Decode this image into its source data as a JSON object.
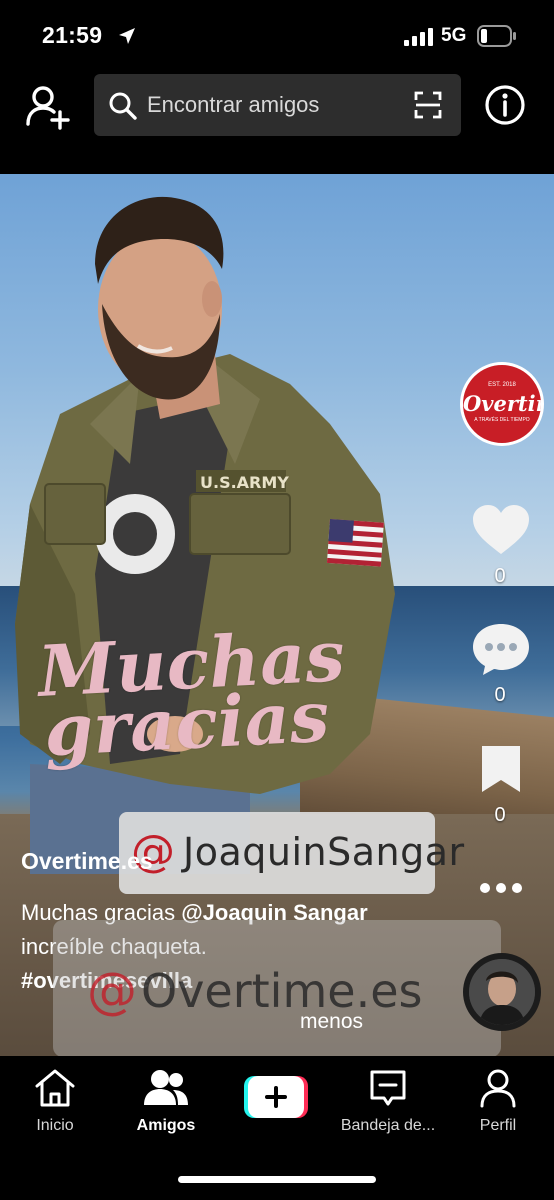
{
  "status_bar": {
    "time": "21:59",
    "network": "5G",
    "battery_level": 0.2
  },
  "top_bar": {
    "search_placeholder": "Encontrar amigos"
  },
  "video": {
    "overlay_line1": "Muchas",
    "overlay_line2": "gracias",
    "tag_at": "@",
    "tag_handle": "JoaquinSangar",
    "jacket_label": "U.S.ARMY"
  },
  "profile_logo": {
    "est": "EST. 2018",
    "brand": "Overtime",
    "sub": "A TRAVÉS DEL TIEMPO"
  },
  "actions": {
    "likes": "0",
    "comments": "0",
    "saves": "0"
  },
  "caption": {
    "username": "Overtime.es",
    "text_1": "Muchas gracias ",
    "mention": "@Joaquin Sangar",
    "text_2": " increíble chaqueta.",
    "hashtag": "#overtimesevilla",
    "less_label": "menos"
  },
  "ad_overlay": {
    "at": "@",
    "brand": "Overtime.es"
  },
  "bottom_nav": {
    "items": [
      {
        "label": "Inicio",
        "icon": "home-icon"
      },
      {
        "label": "Amigos",
        "icon": "friends-icon",
        "active": true
      },
      {
        "label": "",
        "icon": "plus-icon"
      },
      {
        "label": "Bandeja de...",
        "icon": "inbox-icon"
      },
      {
        "label": "Perfil",
        "icon": "profile-icon"
      }
    ]
  },
  "colors": {
    "brand_red": "#c81e26",
    "search_bg": "#2d2d2d",
    "overlay_pink": "#e8b9c4"
  }
}
